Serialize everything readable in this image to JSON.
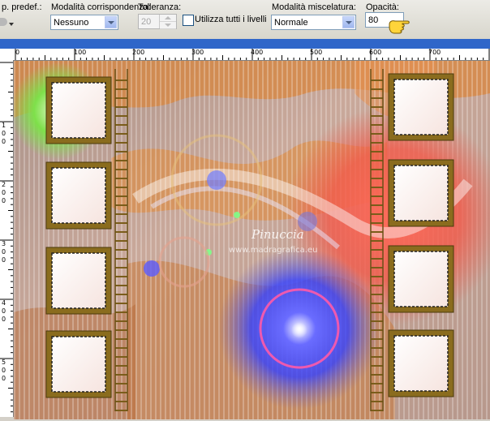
{
  "toolbar": {
    "preset_label": "p. predef.:",
    "match_mode_label": "Modalità corrispondenza:",
    "match_mode_value": "Nessuno",
    "tolerance_label": "Tolleranza:",
    "tolerance_value": "20",
    "use_all_layers_label": "Utilizza tutti i livelli",
    "blend_mode_label": "Modalità miscelatura:",
    "blend_mode_value": "Normale",
    "opacity_label": "Opacità:",
    "opacity_value": "80"
  },
  "ruler": {
    "horizontal": [
      "0",
      "100",
      "200",
      "300",
      "400",
      "500",
      "600",
      "700"
    ],
    "vertical": [
      "100",
      "200",
      "300",
      "400",
      "500"
    ]
  },
  "canvas": {
    "watermark_name": "Pinuccia",
    "watermark_url": "www.madragrafica.eu"
  },
  "colors": {
    "orange": "#d8863e",
    "red_glow": "#f25a4a",
    "blue_orb": "#3340ff",
    "frame_gold": "#8a6c1e"
  }
}
